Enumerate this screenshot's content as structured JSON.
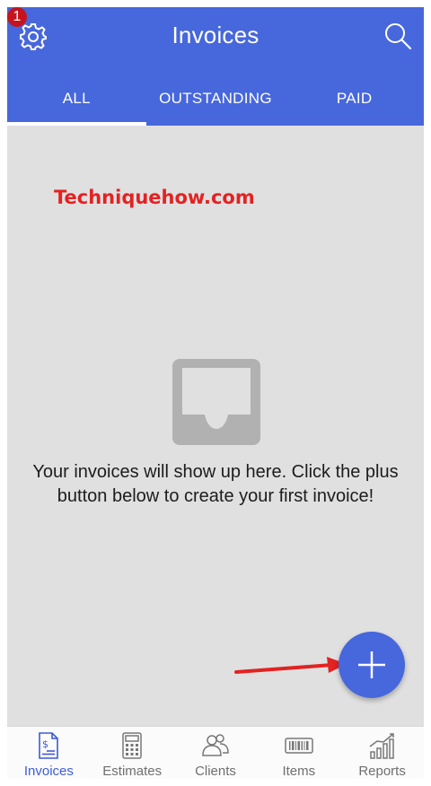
{
  "header": {
    "title": "Invoices",
    "notification_count": "1",
    "settings_icon": "gear-icon",
    "search_icon": "search-icon"
  },
  "tabs": [
    {
      "label": "ALL",
      "active": true
    },
    {
      "label": "OUTSTANDING",
      "active": false
    },
    {
      "label": "PAID",
      "active": false
    }
  ],
  "watermark": "Techniquehow.com",
  "empty_state": {
    "icon": "inbox-icon",
    "line1": "Your invoices will show up here. Click the plus",
    "line2": "button below to create your first invoice!"
  },
  "fab": {
    "icon": "plus-icon"
  },
  "bottom_nav": [
    {
      "label": "Invoices",
      "icon": "invoice-icon",
      "active": true
    },
    {
      "label": "Estimates",
      "icon": "calculator-icon",
      "active": false
    },
    {
      "label": "Clients",
      "icon": "clients-icon",
      "active": false
    },
    {
      "label": "Items",
      "icon": "barcode-icon",
      "active": false
    },
    {
      "label": "Reports",
      "icon": "chart-icon",
      "active": false
    }
  ],
  "colors": {
    "primary": "#4767dc",
    "background": "#e0e0e0",
    "badge": "#c6141e",
    "watermark": "#e32222",
    "nav_active": "#3d5bd6"
  }
}
